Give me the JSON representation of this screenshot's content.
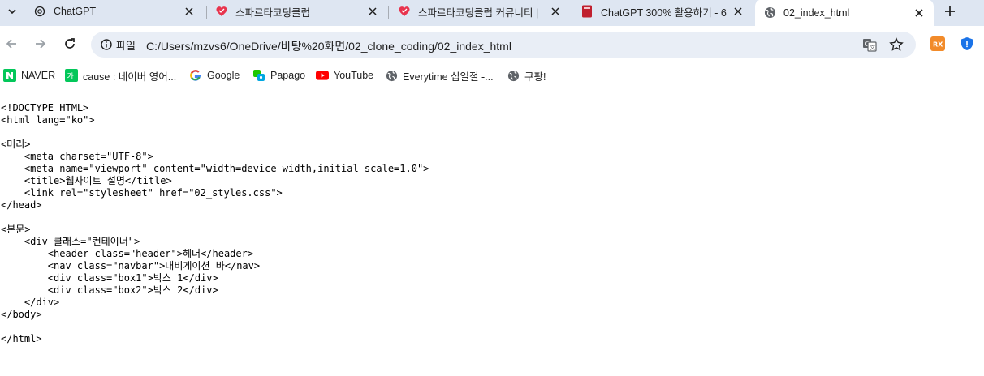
{
  "tabs": [
    {
      "title": "ChatGPT",
      "icon": "chatgpt-icon"
    },
    {
      "title": "스파르타코딩클럽",
      "icon": "sparta-heart-icon"
    },
    {
      "title": "스파르타코딩클럽 커뮤니티 |",
      "icon": "sparta-heart-icon"
    },
    {
      "title": "ChatGPT 300% 활용하기 - 6",
      "icon": "book-icon"
    },
    {
      "title": "02_index_html",
      "icon": "globe-icon",
      "active": true
    }
  ],
  "toolbar": {
    "site_info_label": "파일",
    "url": "C:/Users/mzvs6/OneDrive/바탕%20화면/02_clone_coding/02_index_html"
  },
  "bookmarks": [
    {
      "label": "NAVER",
      "icon": "naver-icon"
    },
    {
      "label": "cause : 네이버 영어...",
      "icon": "naver-dict-icon"
    },
    {
      "label": "Google",
      "icon": "google-icon"
    },
    {
      "label": "Papago",
      "icon": "papago-icon"
    },
    {
      "label": "YouTube",
      "icon": "youtube-icon"
    },
    {
      "label": "Everytime 십일절 -...",
      "icon": "globe-icon"
    },
    {
      "label": "쿠팡!",
      "icon": "globe-icon"
    }
  ],
  "source_lines": [
    "<!DOCTYPE HTML>",
    "<html lang=\"ko\">",
    "",
    "<머리>",
    "    <meta charset=\"UTF-8\">",
    "    <meta name=\"viewport\" content=\"width=device-width,initial-scale=1.0\">",
    "    <title>웹사이트 설명</title>",
    "    <link rel=\"stylesheet\" href=\"02_styles.css\">",
    "</head>",
    "",
    "<본문>",
    "    <div 클래스=\"컨테이너\">",
    "        <header class=\"header\">헤더</header>",
    "        <nav class=\"navbar\">내비게이션 바</nav>",
    "        <div class=\"box1\">박스 1</div>",
    "        <div class=\"box2\">박스 2</div>",
    "    </div>",
    "</body>",
    "",
    "</html>"
  ],
  "colors": {
    "tabstrip_bg": "#dee6f2",
    "omnibox_bg": "#e9eef6",
    "sparta_red": "#e8344e",
    "naver_green": "#03c75a",
    "youtube_red": "#ff0000",
    "security_blue": "#1a73e8",
    "extension_orange": "#f28b2a"
  }
}
